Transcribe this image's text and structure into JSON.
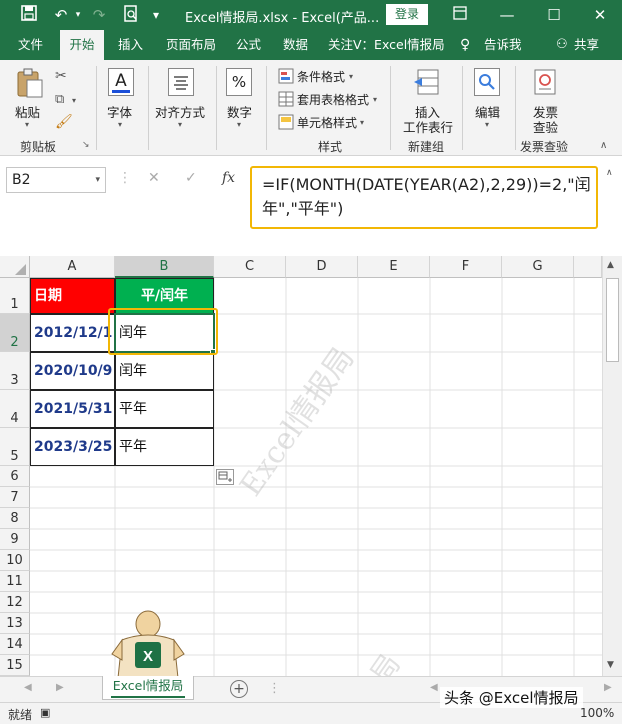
{
  "window": {
    "title": "Excel情报局.xlsx  -  Excel(产品...",
    "login_label": "登录"
  },
  "menu": {
    "items": [
      "文件",
      "开始",
      "插入",
      "页面布局",
      "公式",
      "数据",
      "关注V：Excel情报局",
      "告诉我",
      "共享"
    ],
    "active": "开始"
  },
  "ribbon": {
    "paste_label": "粘贴",
    "clipboard_label": "剪贴板",
    "font_label": "字体",
    "align_label": "对齐方式",
    "number_label": "数字",
    "cond_format_label": "条件格式",
    "table_format_label": "套用表格格式",
    "cell_style_label": "单元格样式",
    "styles_label": "样式",
    "insert_row_label_1": "插入",
    "insert_row_label_2": "工作表行",
    "newgroup_label": "新建组",
    "edit_label": "编辑",
    "invoice_label_1": "发票",
    "invoice_label_2": "查验",
    "invoice_group_label": "发票查验"
  },
  "formula_bar": {
    "name_box": "B2",
    "formula_line1": "=IF(MONTH(DATE(YEAR(A2),2,29))=2,\"闰",
    "formula_line2": "年\",\"平年\")"
  },
  "sheet": {
    "columns": [
      "A",
      "B",
      "C",
      "D",
      "E",
      "F",
      "G"
    ],
    "rows": [
      "1",
      "2",
      "3",
      "4",
      "5",
      "6",
      "7",
      "8",
      "9",
      "10",
      "11",
      "12",
      "13",
      "14",
      "15"
    ],
    "header_a": "日期",
    "header_b": "平/闰年",
    "data": [
      {
        "date": "2012/12/1",
        "type": "闰年"
      },
      {
        "date": "2020/10/9",
        "type": "闰年"
      },
      {
        "date": "2021/5/31",
        "type": "平年"
      },
      {
        "date": "2023/3/25",
        "type": "平年"
      }
    ],
    "watermark": "Excel情报局",
    "watermark2": "局",
    "colors": {
      "header_a_bg": "#ff0000",
      "header_b_bg": "#00b050",
      "highlight": "#f2b705",
      "accent": "#217346"
    }
  },
  "tabs": {
    "active_sheet": "Excel情报局",
    "add_icon": "plus-circle-icon"
  },
  "status": {
    "ready": "就绪",
    "zoom": "100%",
    "signature": "头条 @Excel情报局"
  }
}
